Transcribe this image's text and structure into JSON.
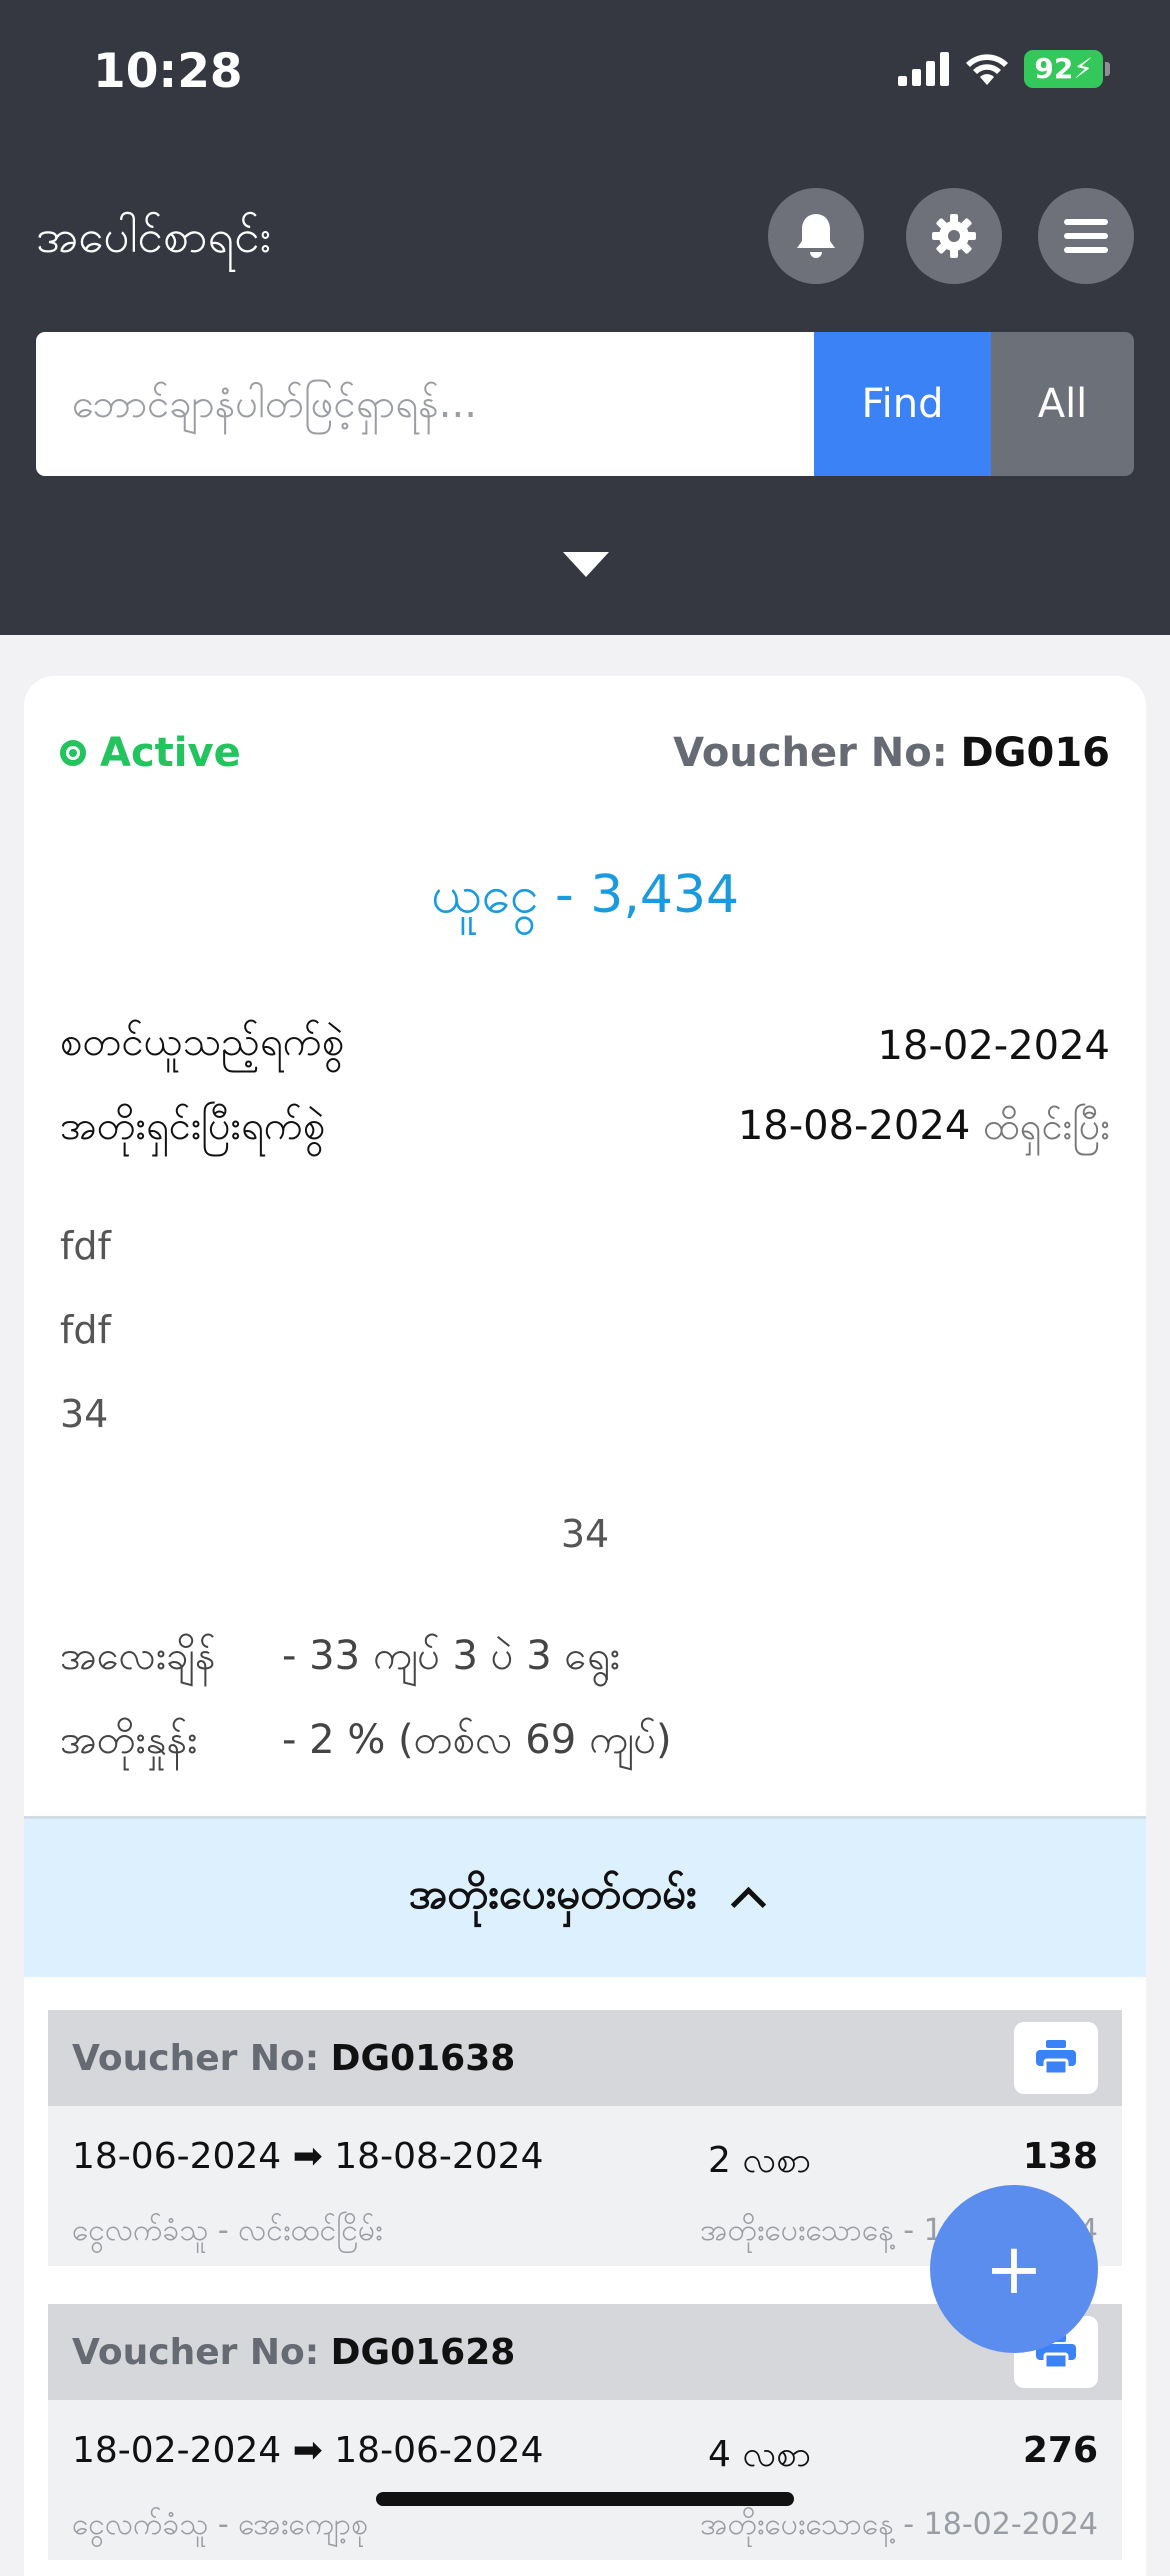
{
  "status_bar": {
    "time": "10:28",
    "battery": "92"
  },
  "header": {
    "title": "အပေါင်စာရင်း",
    "search": {
      "placeholder": "ဘောင်ချာနံပါတ်ဖြင့်ရှာရန်...",
      "value": ""
    },
    "find_label": "Find",
    "all_label": "All"
  },
  "card": {
    "status": "Active",
    "voucher_label": "Voucher No:",
    "voucher_no": "DG016",
    "amount": "ယူငွေ - 3,434",
    "start_label": "စတင်ယူသည့်ရက်စွဲ",
    "start_date": "18-02-2024",
    "end_label": "အတိုးရှင်းပြီးရက်စွဲ",
    "end_date": "18-08-2024",
    "end_suffix": "ထိရှင်းပြီး",
    "notes": [
      "fdf",
      "fdf",
      "34"
    ],
    "center_note": "34",
    "weight_label": "အလေးချိန်",
    "weight_value": "- 33 ကျပ် 3 ပဲ 3 ရွေး",
    "interest_label": "အတိုးနှုန်း",
    "interest_value": "- 2 % (တစ်လ 69 ကျပ်)"
  },
  "history": {
    "title": "အတိုးပေးမှတ်တမ်း",
    "voucher_label": "Voucher No:",
    "items": [
      {
        "voucher_no": "DG01638",
        "dates": "18-06-2024 ➡ 18-08-2024",
        "months": "2 လစာ",
        "amount": "138",
        "receiver": "ငွေလက်ခံသူ - လင်းထင်ငြိမ်း",
        "paid_date": "အတိုးပေးသောနေ့ - 18-08-2024"
      },
      {
        "voucher_no": "DG01628",
        "dates": "18-02-2024 ➡ 18-06-2024",
        "months": "4 လစာ",
        "amount": "276",
        "receiver": "ငွေလက်ခံသူ - အေးကျော့စု",
        "paid_date": "အတိုးပေးသောနေ့ - 18-02-2024"
      }
    ]
  },
  "fab": {
    "label": "+"
  },
  "colors": {
    "accent": "#3b82f6",
    "active": "#23c35d",
    "amount": "#1a9be0",
    "header_bg": "#353841"
  }
}
